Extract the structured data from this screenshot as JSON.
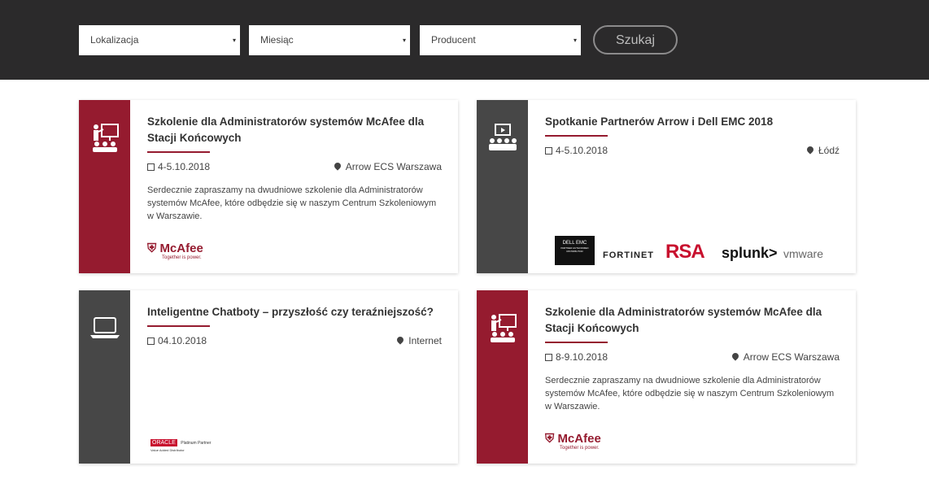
{
  "filters": {
    "location": "Lokalizacja",
    "month": "Miesiąc",
    "producer": "Producent",
    "caret": "▾",
    "search_label": "Szukaj"
  },
  "cards": [
    {
      "title": "Szkolenie dla Administratorów systemów McAfee dla Stacji Końcowych",
      "date": "4-5.10.2018",
      "location": "Arrow ECS Warszawa",
      "description": "Serdecznie zapraszamy na dwudniowe szkolenie dla Administratorów systemów McAfee, które odbędzie się w naszym Centrum Szkoleniowym w Warszawie.",
      "side_color": "#951b2f",
      "icon": "presentation-icon",
      "logo_text": "McAfee",
      "logo_tagline": "Together is power."
    },
    {
      "title": "Spotkanie Partnerów Arrow i Dell EMC 2018",
      "date": "4-5.10.2018",
      "location": "Łódź",
      "side_color": "#474747",
      "icon": "video-audience-icon",
      "logos": {
        "dell": "DELL EMC",
        "dell_sub": "PARTNER AUTHORIZED DISTRIBUTOR",
        "fortinet": "FORTINET",
        "rsa": "RSA",
        "splunk": "splunk>",
        "vmware": "vmware"
      }
    },
    {
      "title": "Inteligentne Chatboty – przyszłość czy teraźniejszość?",
      "date": "04.10.2018",
      "location": "Internet",
      "side_color": "#474747",
      "icon": "laptop-icon",
      "logo_text": "ORACLE",
      "logo_tagline": "Platinum Partner",
      "logo_sub": "Value Added Distributor"
    },
    {
      "title": "Szkolenie dla Administratorów systemów McAfee dla Stacji Końcowych",
      "date": "8-9.10.2018",
      "location": "Arrow ECS Warszawa",
      "description": "Serdecznie zapraszamy na dwudniowe szkolenie dla Administratorów systemów McAfee, które odbędzie się w naszym Centrum Szkoleniowym w Warszawie.",
      "side_color": "#951b2f",
      "icon": "presentation-icon",
      "logo_text": "McAfee",
      "logo_tagline": "Together is power."
    }
  ]
}
